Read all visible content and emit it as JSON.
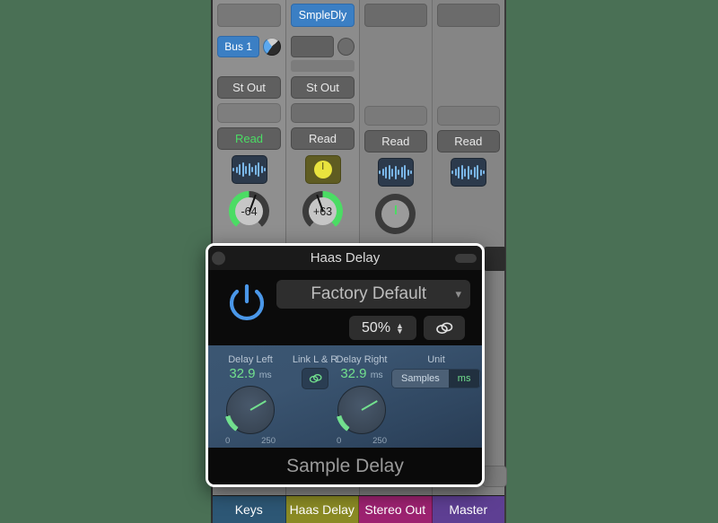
{
  "background_color": "#4a7055",
  "mixer": {
    "strips": [
      {
        "name": "keys-strip",
        "insert_slot": "",
        "send_label": "Bus 1",
        "send_knob": "send-knob",
        "output": "St Out",
        "group": "",
        "automation": "Read",
        "automation_active": true,
        "icon": "waveform-icon",
        "pan_value": "-64",
        "selected": true
      },
      {
        "name": "haas-delay-strip",
        "insert_slot": "SmpleDly",
        "send_label": "",
        "send_knob": "send-knob-empty",
        "output": "St Out",
        "group": "",
        "automation": "Read",
        "automation_active": false,
        "icon": "metronome-icon",
        "pan_value": "+63",
        "selected": false
      },
      {
        "name": "stereo-out-strip",
        "insert_slot": "",
        "send_label": "",
        "send_knob": "",
        "output": "",
        "group": "",
        "automation": "Read",
        "automation_active": false,
        "icon": "waveform-icon",
        "pan_value": "",
        "selected": false
      },
      {
        "name": "master-strip",
        "insert_slot": "",
        "send_label": "",
        "send_knob": "",
        "output": "",
        "group": "",
        "automation": "Read",
        "automation_active": false,
        "icon": "waveform-icon",
        "pan_value": "",
        "selected": false
      }
    ],
    "tabs": [
      {
        "label": "Keys",
        "color": "#2d5775"
      },
      {
        "label": "Haas Delay",
        "color": "#8a8a24"
      },
      {
        "label": "Stereo Out",
        "color": "#9c2270"
      },
      {
        "label": "Master",
        "color": "#5e3f93"
      }
    ]
  },
  "plugin": {
    "title": "Haas Delay",
    "power_icon": "power-icon",
    "power_color": "#4a97e8",
    "preset": {
      "value": "Factory Default",
      "chevron": "chevron-down-icon"
    },
    "zoom": {
      "value": "50%",
      "stepper": "stepper-icon"
    },
    "link_button_icon": "link-icon",
    "params": {
      "delay_left": {
        "label": "Delay Left",
        "value": "32.9",
        "unit": "ms",
        "min": "0",
        "max": "250"
      },
      "link": {
        "label": "Link L & R",
        "icon": "link-icon"
      },
      "delay_right": {
        "label": "Delay Right",
        "value": "32.9",
        "unit": "ms",
        "min": "0",
        "max": "250"
      },
      "unit": {
        "label": "Unit",
        "options": [
          "Samples",
          "ms"
        ],
        "selected": "ms"
      }
    },
    "footer": "Sample Delay",
    "accent_green": "#72e08e"
  }
}
